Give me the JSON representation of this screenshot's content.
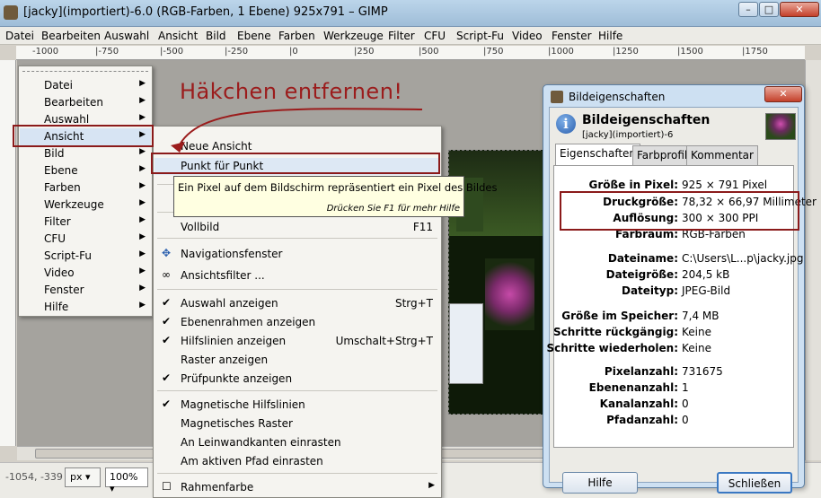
{
  "window": {
    "title": "[jacky](importiert)-6.0 (RGB-Farben, 1 Ebene) 925x791 – GIMP"
  },
  "menubar": [
    "Datei",
    "Bearbeiten",
    "Auswahl",
    "Ansicht",
    "Bild",
    "Ebene",
    "Farben",
    "Werkzeuge",
    "Filter",
    "CFU",
    "Script-Fu",
    "Video",
    "Fenster",
    "Hilfe"
  ],
  "ruler_labels": [
    "-1000",
    "|-750",
    "|-500",
    "|-250",
    "|0",
    "|250",
    "|500",
    "|750",
    "|1000",
    "|1250",
    "|1500",
    "|1750"
  ],
  "main_menu": [
    "Datei",
    "Bearbeiten",
    "Auswahl",
    "Ansicht",
    "Bild",
    "Ebene",
    "Farben",
    "Werkzeuge",
    "Filter",
    "CFU",
    "Script-Fu",
    "Video",
    "Fenster",
    "Hilfe"
  ],
  "submenu": {
    "items": [
      {
        "label": "Neue Ansicht",
        "accel": "",
        "checked": false
      },
      {
        "label": "Punkt für Punkt",
        "accel": "",
        "checked": false
      },
      {
        "label": "Vollbild",
        "accel": "F11",
        "checked": false
      },
      {
        "label": "Navigationsfenster",
        "accel": "",
        "checked": false
      },
      {
        "label": "Ansichtsfilter ...",
        "accel": "",
        "checked": false
      },
      {
        "label": "Auswahl anzeigen",
        "accel": "Strg+T",
        "checked": true
      },
      {
        "label": "Ebenenrahmen anzeigen",
        "accel": "",
        "checked": true
      },
      {
        "label": "Hilfslinien anzeigen",
        "accel": "Umschalt+Strg+T",
        "checked": true
      },
      {
        "label": "Raster anzeigen",
        "accel": "",
        "checked": false
      },
      {
        "label": "Prüfpunkte anzeigen",
        "accel": "",
        "checked": true
      },
      {
        "label": "Magnetische Hilfslinien",
        "accel": "",
        "checked": true
      },
      {
        "label": "Magnetisches Raster",
        "accel": "",
        "checked": false
      },
      {
        "label": "An Leinwandkanten einrasten",
        "accel": "",
        "checked": false
      },
      {
        "label": "Am aktiven Pfad einrasten",
        "accel": "",
        "checked": false
      },
      {
        "label": "Rahmenfarbe",
        "accel": "",
        "checked": false
      }
    ]
  },
  "tooltip": {
    "text": "Ein Pixel auf dem Bildschirm repräsentiert ein Pixel des Bildes",
    "help": "Drücken Sie F1 für mehr Hilfe"
  },
  "annotation": "Häkchen entfernen!",
  "status": {
    "coords": "-1054, -339",
    "unit": "px",
    "zoom": "100%"
  },
  "dialog": {
    "window_title": "Bildeigenschaften",
    "header": "Bildeigenschaften",
    "subheader": "[jacky](importiert)-6",
    "tabs": [
      "Eigenschaften",
      "Farbprofil",
      "Kommentar"
    ],
    "properties": [
      {
        "k": "Größe in Pixel:",
        "v": "925 × 791 Pixel"
      },
      {
        "k": "Druckgröße:",
        "v": "78,32 × 66,97 Millimeter"
      },
      {
        "k": "Auflösung:",
        "v": "300 × 300 PPI"
      },
      {
        "k": "Farbraum:",
        "v": "RGB-Farben"
      },
      {
        "k": "Dateiname:",
        "v": "C:\\Users\\L...p\\jacky.jpg"
      },
      {
        "k": "Dateigröße:",
        "v": "204,5 kB"
      },
      {
        "k": "Dateityp:",
        "v": "JPEG-Bild"
      },
      {
        "k": "Größe im Speicher:",
        "v": "7,4 MB"
      },
      {
        "k": "Schritte rückgängig:",
        "v": "Keine"
      },
      {
        "k": "Schritte wiederholen:",
        "v": "Keine"
      },
      {
        "k": "Pixelanzahl:",
        "v": "731675"
      },
      {
        "k": "Ebenenanzahl:",
        "v": "1"
      },
      {
        "k": "Kanalanzahl:",
        "v": "0"
      },
      {
        "k": "Pfadanzahl:",
        "v": "0"
      }
    ],
    "help_button": "Hilfe",
    "close_button": "Schließen"
  }
}
